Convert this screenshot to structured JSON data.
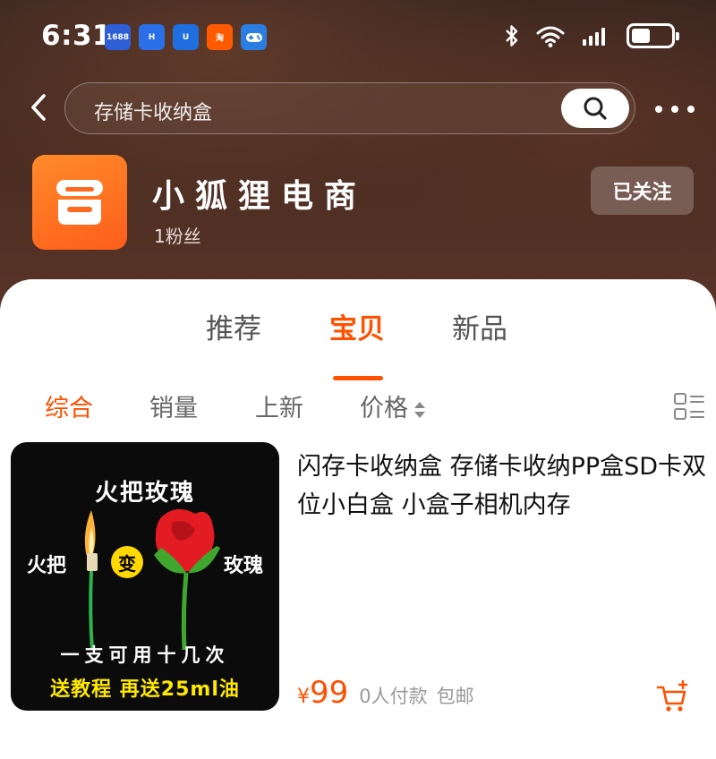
{
  "status_bar": {
    "time": "6:31",
    "app_icons": [
      {
        "name": "1688-app-icon",
        "label": "1688",
        "color": "#2f5fd6"
      },
      {
        "name": "app-h-icon",
        "label": "H",
        "color": "#2b6fe8"
      },
      {
        "name": "app-u-icon",
        "label": "U",
        "color": "#1f6fe0"
      },
      {
        "name": "taobao-app-icon",
        "label": "淘",
        "color": "#ff5a00"
      },
      {
        "name": "game-app-icon",
        "label": "",
        "color": "#2a7de1"
      }
    ]
  },
  "search": {
    "query": "存储卡收纳盒"
  },
  "shop": {
    "name": "小狐狸电商",
    "fans": "1粉丝",
    "follow_label": "已关注"
  },
  "tabs": [
    {
      "label": "推荐",
      "active": false
    },
    {
      "label": "宝贝",
      "active": true
    },
    {
      "label": "新品",
      "active": false
    }
  ],
  "filters": [
    {
      "label": "综合",
      "active": true
    },
    {
      "label": "销量",
      "active": false
    },
    {
      "label": "上新",
      "active": false
    },
    {
      "label": "价格",
      "active": false
    }
  ],
  "product": {
    "title": "闪存卡收纳盒 存储卡收纳PP盒SD卡双位小白盒 小盒子相机内存",
    "price_symbol": "¥",
    "price": "99",
    "sold": "0人付款",
    "shipping": "包邮",
    "image": {
      "title": "火把玫瑰",
      "left_text": "火把",
      "badge": "变",
      "right_text": "玫瑰",
      "line1": "一支可用十几次",
      "line2": "送教程 再送25ml油"
    }
  },
  "colors": {
    "accent": "#ff5000",
    "header_bg": "#4a2c22"
  }
}
